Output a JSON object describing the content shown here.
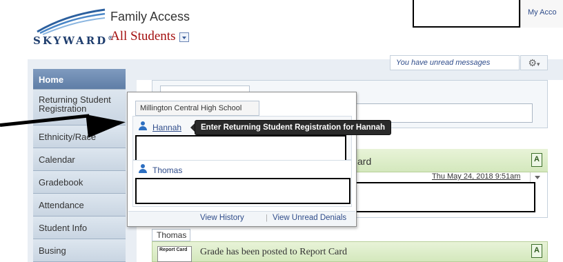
{
  "header": {
    "logo_text": "SKYWARD",
    "logo_reg": "®",
    "app_title": "Family Access",
    "student_select": "All Students",
    "my_account": "My Acco"
  },
  "toolbar": {
    "unread_messages": "You have unread messages",
    "gear_icon": "gear-icon"
  },
  "sidebar": {
    "items": [
      {
        "label": "Home"
      },
      {
        "label": "Returning Student Registration"
      },
      {
        "label": "Ethnicity/Race"
      },
      {
        "label": "Calendar"
      },
      {
        "label": "Gradebook"
      },
      {
        "label": "Attendance"
      },
      {
        "label": "Student Info"
      },
      {
        "label": "Busing"
      }
    ]
  },
  "popup": {
    "school_name": "Millington Central High School",
    "students": [
      {
        "name": "Hannah"
      },
      {
        "name": "Thomas"
      }
    ],
    "tooltip": "Enter Returning Student Registration for Hannah",
    "footer": {
      "view_history": "View History",
      "separator": "|",
      "view_unread_denials": "View Unread Denials"
    }
  },
  "feed": {
    "gradebook_title": "ard",
    "gradebook_date": "Thu May 24, 2018 9:51am",
    "student_tab": "Thomas",
    "report_card_icon_label": "Report Card",
    "report_card_title": "Grade has been posted to Report Card"
  },
  "colors": {
    "brand_blue": "#1f3e6e",
    "student_red": "#a30e0e",
    "link_blue": "#2f4c8a",
    "nav_active": "#6a88b0",
    "panel_green": "#dcecc8"
  }
}
